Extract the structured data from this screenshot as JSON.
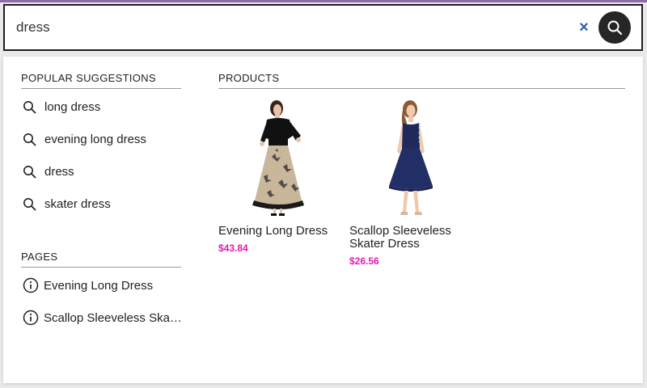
{
  "search": {
    "value": "dress",
    "placeholder": "",
    "clear_glyph": "×"
  },
  "suggestions": {
    "title": "POPULAR SUGGESTIONS",
    "items": [
      {
        "label": "long dress",
        "icon": "search-icon"
      },
      {
        "label": "evening long dress",
        "icon": "search-icon"
      },
      {
        "label": "dress",
        "icon": "search-icon"
      },
      {
        "label": "skater dress",
        "icon": "search-icon"
      }
    ]
  },
  "pages": {
    "title": "PAGES",
    "items": [
      {
        "label": "Evening Long Dress",
        "icon": "info-icon"
      },
      {
        "label": "Scallop Sleeveless Skater Dress",
        "icon": "info-icon"
      }
    ]
  },
  "products": {
    "title": "PRODUCTS",
    "items": [
      {
        "name": "Evening Long Dress",
        "price": "$43.84"
      },
      {
        "name": "Scallop Sleeveless Skater Dress",
        "price": "$26.56"
      }
    ]
  },
  "colors": {
    "price": "#e21ab4",
    "clear_icon": "#2d5fa3",
    "search_button": "#262626"
  }
}
